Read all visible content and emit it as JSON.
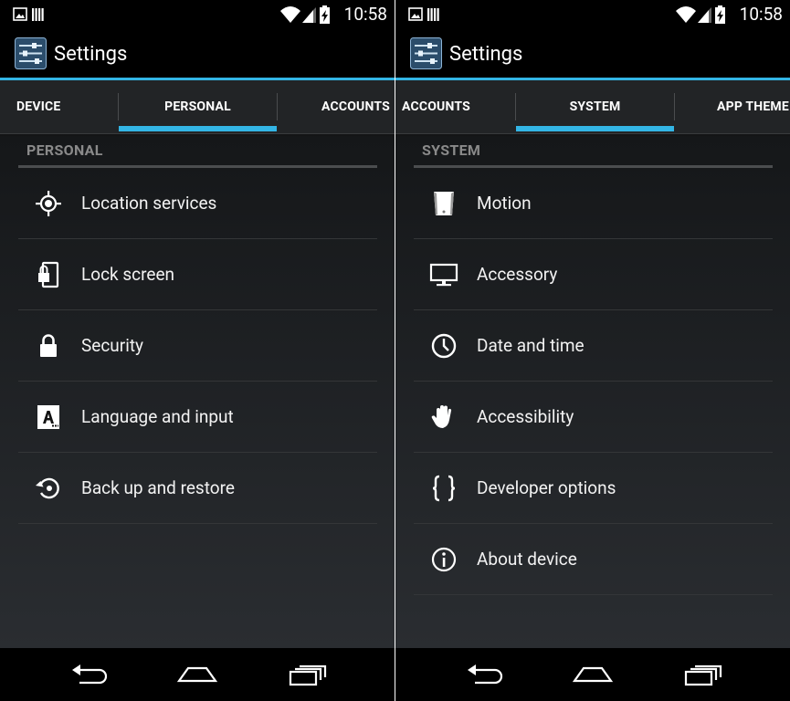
{
  "status_bar": {
    "time": "10:58"
  },
  "app": {
    "title": "Settings"
  },
  "colors": {
    "accent": "#33b5e5",
    "background": "#121212",
    "navbar": "#000000"
  },
  "left_panel": {
    "tabs": [
      {
        "label": "DEVICE"
      },
      {
        "label": "PERSONAL",
        "selected": true
      },
      {
        "label": "ACCOUNTS"
      }
    ],
    "section_title": "PERSONAL",
    "items": [
      {
        "label": "Location services",
        "icon": "location-icon"
      },
      {
        "label": "Lock screen",
        "icon": "lock-screen-icon"
      },
      {
        "label": "Security",
        "icon": "padlock-icon"
      },
      {
        "label": "Language and input",
        "icon": "language-icon"
      },
      {
        "label": "Back up and restore",
        "icon": "backup-restore-icon"
      }
    ]
  },
  "right_panel": {
    "tabs": [
      {
        "label": "ACCOUNTS"
      },
      {
        "label": "SYSTEM",
        "selected": true
      },
      {
        "label": "APP THEME"
      }
    ],
    "section_title": "SYSTEM",
    "items": [
      {
        "label": "Motion",
        "icon": "motion-icon"
      },
      {
        "label": "Accessory",
        "icon": "monitor-icon"
      },
      {
        "label": "Date and time",
        "icon": "clock-icon"
      },
      {
        "label": "Accessibility",
        "icon": "hand-icon"
      },
      {
        "label": "Developer options",
        "icon": "braces-icon"
      },
      {
        "label": "About device",
        "icon": "info-icon"
      }
    ]
  }
}
